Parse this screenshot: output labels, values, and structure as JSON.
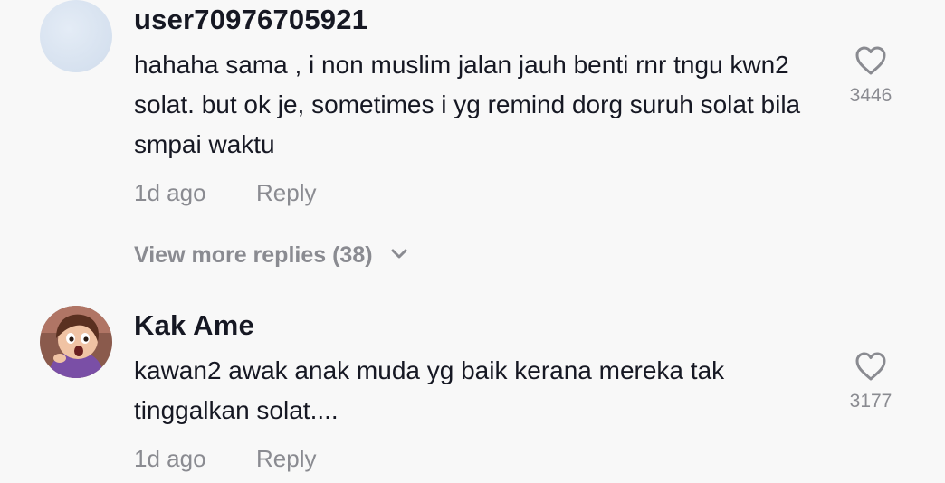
{
  "comments": [
    {
      "username": "user70976705921",
      "text": "hahaha sama , i non muslim jalan jauh benti rnr tngu kwn2 solat. but ok je, sometimes i yg remind dorg suruh solat bila smpai waktu",
      "time": "1d ago",
      "reply_label": "Reply",
      "like_count": "3446",
      "avatar_icon": "default-avatar"
    },
    {
      "username": "Kak Ame",
      "text": "kawan2 awak anak muda yg baik kerana mereka tak tinggalkan solat....",
      "time": "1d ago",
      "reply_label": "Reply",
      "like_count": "3177",
      "avatar_icon": "cartoon-girl-avatar"
    }
  ],
  "view_more": {
    "label": "View more replies (38)",
    "icon": "chevron-down-icon"
  },
  "colors": {
    "background": "#f8f8f8",
    "text": "#161823",
    "muted": "#8a8b91"
  }
}
